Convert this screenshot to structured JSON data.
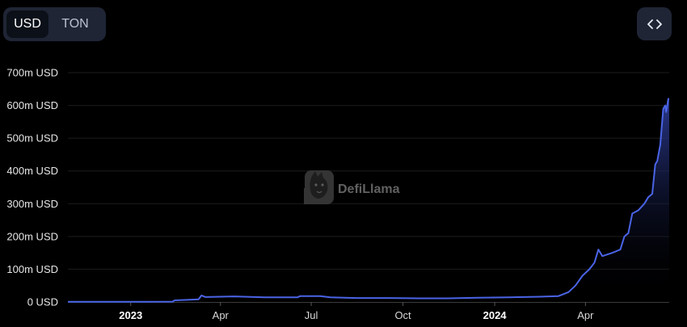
{
  "currency_toggle": {
    "options": [
      {
        "label": "USD",
        "active": true
      },
      {
        "label": "TON",
        "active": false
      }
    ]
  },
  "embed_button": {
    "icon": "code-icon"
  },
  "watermark": {
    "text": "DefiLlama",
    "icon": "llama-logo-icon"
  },
  "colors": {
    "line": "#4a64e6",
    "area_top": "#2f3f9e",
    "background": "#000000",
    "grid": "#1c1c1c"
  },
  "chart_data": {
    "type": "area",
    "title": "",
    "xlabel": "",
    "ylabel": "",
    "y_ticks": [
      {
        "value": 0,
        "label": "0 USD"
      },
      {
        "value": 100,
        "label": "100m USD"
      },
      {
        "value": 200,
        "label": "200m USD"
      },
      {
        "value": 300,
        "label": "300m USD"
      },
      {
        "value": 400,
        "label": "400m USD"
      },
      {
        "value": 500,
        "label": "500m USD"
      },
      {
        "value": 600,
        "label": "600m USD"
      },
      {
        "value": 700,
        "label": "700m USD"
      }
    ],
    "ylim": [
      0,
      700
    ],
    "xlim": [
      "2022-10-30",
      "2024-06-24"
    ],
    "x_ticks": [
      {
        "date": "2023-01-01",
        "label": "2023",
        "bold": true
      },
      {
        "date": "2023-04-01",
        "label": "Apr",
        "bold": false
      },
      {
        "date": "2023-07-01",
        "label": "Jul",
        "bold": false
      },
      {
        "date": "2023-10-01",
        "label": "Oct",
        "bold": false
      },
      {
        "date": "2024-01-01",
        "label": "2024",
        "bold": true
      },
      {
        "date": "2024-04-01",
        "label": "Apr",
        "bold": false
      }
    ],
    "grid": true,
    "series": [
      {
        "points": [
          [
            "2022-10-30",
            0.5
          ],
          [
            "2022-12-01",
            0.5
          ],
          [
            "2023-01-15",
            0.6
          ],
          [
            "2023-02-12",
            1
          ],
          [
            "2023-02-14",
            5
          ],
          [
            "2023-03-01",
            7
          ],
          [
            "2023-03-10",
            8
          ],
          [
            "2023-03-13",
            20
          ],
          [
            "2023-03-17",
            15
          ],
          [
            "2023-04-15",
            17
          ],
          [
            "2023-05-15",
            14
          ],
          [
            "2023-06-17",
            14
          ],
          [
            "2023-06-20",
            18
          ],
          [
            "2023-07-10",
            18
          ],
          [
            "2023-07-20",
            14
          ],
          [
            "2023-08-15",
            12
          ],
          [
            "2023-09-15",
            12
          ],
          [
            "2023-10-15",
            11
          ],
          [
            "2023-11-15",
            11
          ],
          [
            "2023-12-15",
            13
          ],
          [
            "2024-01-15",
            14
          ],
          [
            "2024-02-15",
            16
          ],
          [
            "2024-03-05",
            18
          ],
          [
            "2024-03-15",
            30
          ],
          [
            "2024-03-22",
            50
          ],
          [
            "2024-03-29",
            80
          ],
          [
            "2024-04-05",
            100
          ],
          [
            "2024-04-10",
            120
          ],
          [
            "2024-04-14",
            160
          ],
          [
            "2024-04-18",
            140
          ],
          [
            "2024-04-28",
            150
          ],
          [
            "2024-05-06",
            160
          ],
          [
            "2024-05-10",
            200
          ],
          [
            "2024-05-14",
            210
          ],
          [
            "2024-05-18",
            270
          ],
          [
            "2024-05-24",
            280
          ],
          [
            "2024-05-30",
            300
          ],
          [
            "2024-06-03",
            320
          ],
          [
            "2024-06-07",
            330
          ],
          [
            "2024-06-10",
            420
          ],
          [
            "2024-06-12",
            430
          ],
          [
            "2024-06-15",
            480
          ],
          [
            "2024-06-18",
            590
          ],
          [
            "2024-06-20",
            600
          ],
          [
            "2024-06-21",
            580
          ],
          [
            "2024-06-23",
            620
          ],
          [
            "2024-06-24",
            620
          ]
        ]
      }
    ]
  }
}
